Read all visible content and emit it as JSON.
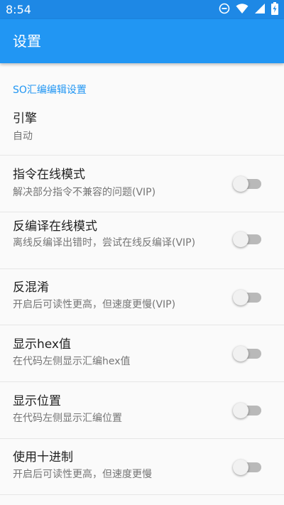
{
  "status_bar": {
    "time": "8:54",
    "icons": [
      "do-not-disturb-icon",
      "wifi-icon",
      "cellular-signal-icon",
      "battery-charging-icon"
    ]
  },
  "app_bar": {
    "title": "设置"
  },
  "category": {
    "title": "SO汇编编辑设置"
  },
  "preferences": [
    {
      "title": "引擎",
      "summary": "自动",
      "has_switch": false
    },
    {
      "title": "指令在线模式",
      "summary": "解决部分指令不兼容的问题(VIP)",
      "has_switch": true,
      "checked": false
    },
    {
      "title": "反编译在线模式",
      "summary": "离线反编译出错时，尝试在线反编译(VIP)",
      "has_switch": true,
      "checked": false
    },
    {
      "title": "反混淆",
      "summary": "开启后可读性更高，但速度更慢(VIP)",
      "has_switch": true,
      "checked": false
    },
    {
      "title": "显示hex值",
      "summary": "在代码左侧显示汇编hex值",
      "has_switch": true,
      "checked": false
    },
    {
      "title": "显示位置",
      "summary": "在代码左侧显示汇编位置",
      "has_switch": true,
      "checked": false
    },
    {
      "title": "使用十进制",
      "summary": "开启后可读性更高，但速度更慢",
      "has_switch": true,
      "checked": false
    }
  ],
  "colors": {
    "primary": "#2196f3",
    "primary_dark": "#1e88e5",
    "background": "#fafafa"
  }
}
